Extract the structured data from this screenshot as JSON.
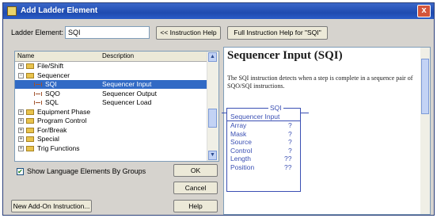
{
  "window": {
    "title": "Add Ladder Element",
    "close_symbol": "x"
  },
  "form": {
    "ladder_element_label": "Ladder Element:",
    "ladder_element_value": "SQI",
    "instruction_help_button": "<< Instruction Help",
    "full_help_button": "Full Instruction Help for \"SQI\""
  },
  "tree": {
    "columns": {
      "name": "Name",
      "description": "Description"
    },
    "rows": [
      {
        "type": "folder",
        "expander": "+",
        "name": "File/Shift",
        "desc": ""
      },
      {
        "type": "folder",
        "expander": "-",
        "name": "Sequencer",
        "desc": ""
      },
      {
        "type": "instr",
        "expander": "",
        "name": "SQI",
        "desc": "Sequencer Input",
        "selected": true
      },
      {
        "type": "instr",
        "expander": "",
        "name": "SQO",
        "desc": "Sequencer Output"
      },
      {
        "type": "instr",
        "expander": "",
        "name": "SQL",
        "desc": "Sequencer Load"
      },
      {
        "type": "folder",
        "expander": "+",
        "name": "Equipment Phase",
        "desc": ""
      },
      {
        "type": "folder",
        "expander": "+",
        "name": "Program Control",
        "desc": ""
      },
      {
        "type": "folder",
        "expander": "+",
        "name": "For/Break",
        "desc": ""
      },
      {
        "type": "folder",
        "expander": "+",
        "name": "Special",
        "desc": ""
      },
      {
        "type": "folder",
        "expander": "+",
        "name": "Trig Functions",
        "desc": ""
      }
    ]
  },
  "show_groups": {
    "checked": true,
    "label": "Show Language Elements By Groups"
  },
  "buttons": {
    "ok": "OK",
    "cancel": "Cancel",
    "help": "Help",
    "new_aoi": "New Add-On Instruction..."
  },
  "help": {
    "title": "Sequencer Input (SQI)",
    "description": "The SQI instruction detects when a step is complete in a sequence pair of SQO/SQI instructions.",
    "block": {
      "name": "SQI",
      "header": "Sequencer Input",
      "params": [
        {
          "label": "Array",
          "value": "?"
        },
        {
          "label": "Mask",
          "value": "?"
        },
        {
          "label": "Source",
          "value": "?"
        },
        {
          "label": "Control",
          "value": "?"
        },
        {
          "label": "Length",
          "value": "??"
        },
        {
          "label": "Position",
          "value": "??"
        }
      ]
    }
  },
  "colors": {
    "titlebar": "#2a5cc7",
    "selection": "#316ac5",
    "block": "#3a4fb3"
  }
}
